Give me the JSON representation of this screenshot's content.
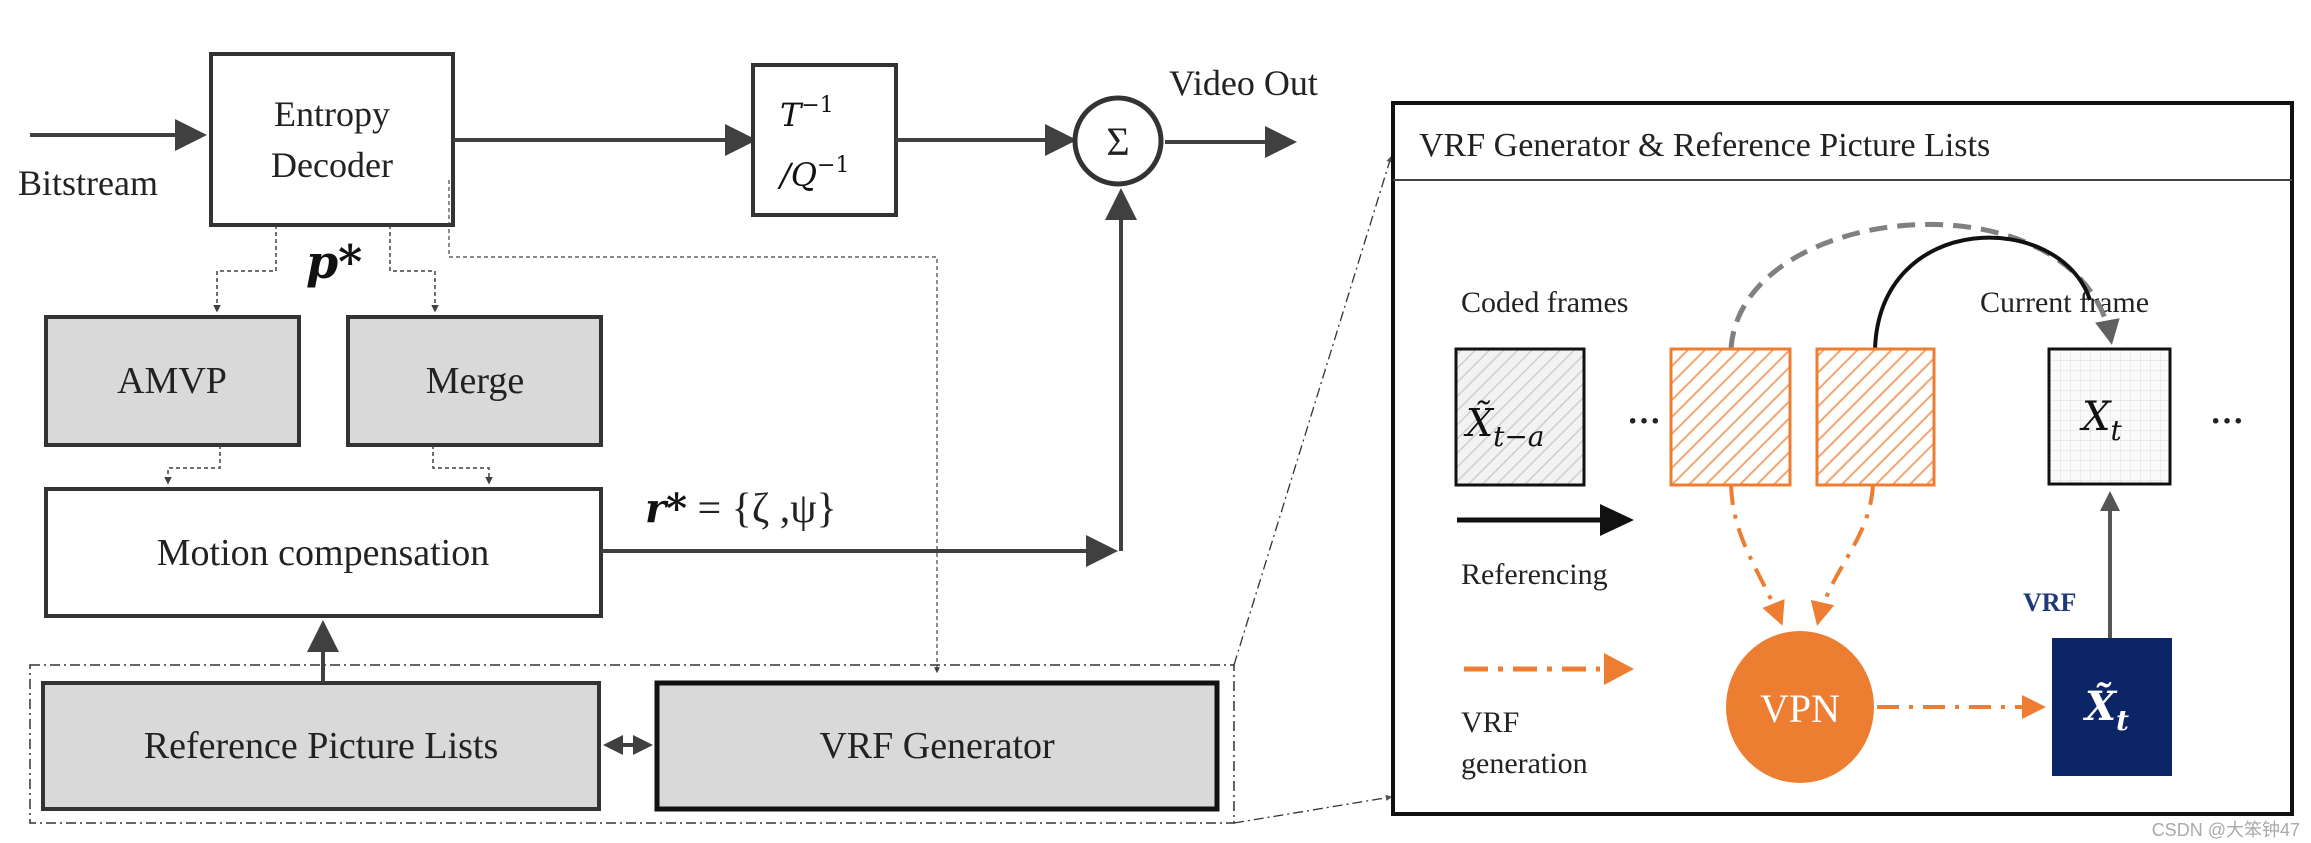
{
  "left": {
    "input_label": "Bitstream",
    "entropy_decoder": [
      "Entropy",
      "Decoder"
    ],
    "transform": {
      "line1_base": "T",
      "line1_sup": "−1",
      "line2_base": "/Q",
      "line2_sup": "−1"
    },
    "sum_symbol": "Σ",
    "output_label": "Video Out",
    "p_star": "p*",
    "amvp": "AMVP",
    "merge": "Merge",
    "motion_compensation": "Motion compensation",
    "r_star": {
      "lhs": "r*",
      "rhs": " = {ζ ,ψ}"
    },
    "reference_picture_lists": "Reference Picture Lists",
    "vrf_generator": "VRF Generator"
  },
  "panel": {
    "title": "VRF Generator & Reference Picture Lists",
    "coded_frames": "Coded frames",
    "current_frame": "Current frame",
    "frame_past": {
      "base": "X̃",
      "sub": "t−a"
    },
    "frame_current": {
      "base": "X",
      "sub": "t"
    },
    "frame_vrf": {
      "base": "X̃",
      "sub": "t"
    },
    "ellipsis": "···",
    "legend_referencing": "Referencing",
    "legend_vrf_generation": [
      "VRF",
      "generation"
    ],
    "vpn": "VPN",
    "vrf_label": "VRF"
  },
  "watermark": "CSDN @大笨钟47",
  "colors": {
    "orange": "#ED7D31",
    "navy": "#0B2566",
    "box_gray": "#D9D9D9",
    "line": "#404040",
    "dashed_gray": "#808080"
  }
}
